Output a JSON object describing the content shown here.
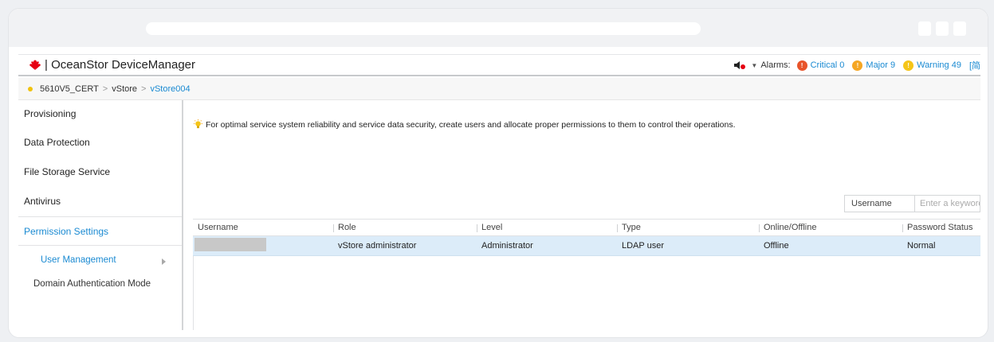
{
  "app": {
    "title": "OceanStor DeviceManager",
    "brand_colors": {
      "accent": "#1a8ad2",
      "logo": "#e60012"
    }
  },
  "alarms": {
    "label": "Alarms:",
    "critical": {
      "label": "Critical 0",
      "color": "#e8542a"
    },
    "major": {
      "label": "Major 9",
      "color": "#f5a623"
    },
    "warning": {
      "label": "Warning 49",
      "color": "#f5c518"
    },
    "extra": "[简"
  },
  "breadcrumb": {
    "items": [
      "5610V5_CERT",
      "vStore",
      "vStore004"
    ],
    "separator": ">"
  },
  "sidebar": {
    "items": [
      "Provisioning",
      "Data Protection",
      "File Storage Service",
      "Antivirus",
      "Permission Settings"
    ],
    "subitems": [
      "User Management",
      "Domain Authentication Mode"
    ]
  },
  "main": {
    "tip": "For optimal service system reliability and service data security, create users and allocate proper permissions to them to control their operations.",
    "search": {
      "field_label": "Username",
      "placeholder": "Enter a keyword",
      "value": ""
    },
    "table": {
      "headers": [
        "Username",
        "Role",
        "Level",
        "Type",
        "Online/Offline",
        "Password Status"
      ],
      "rows": [
        {
          "username": "",
          "role": "vStore administrator",
          "level": "Administrator",
          "type": "LDAP user",
          "online": "Offline",
          "password_status": "Normal"
        }
      ]
    }
  }
}
